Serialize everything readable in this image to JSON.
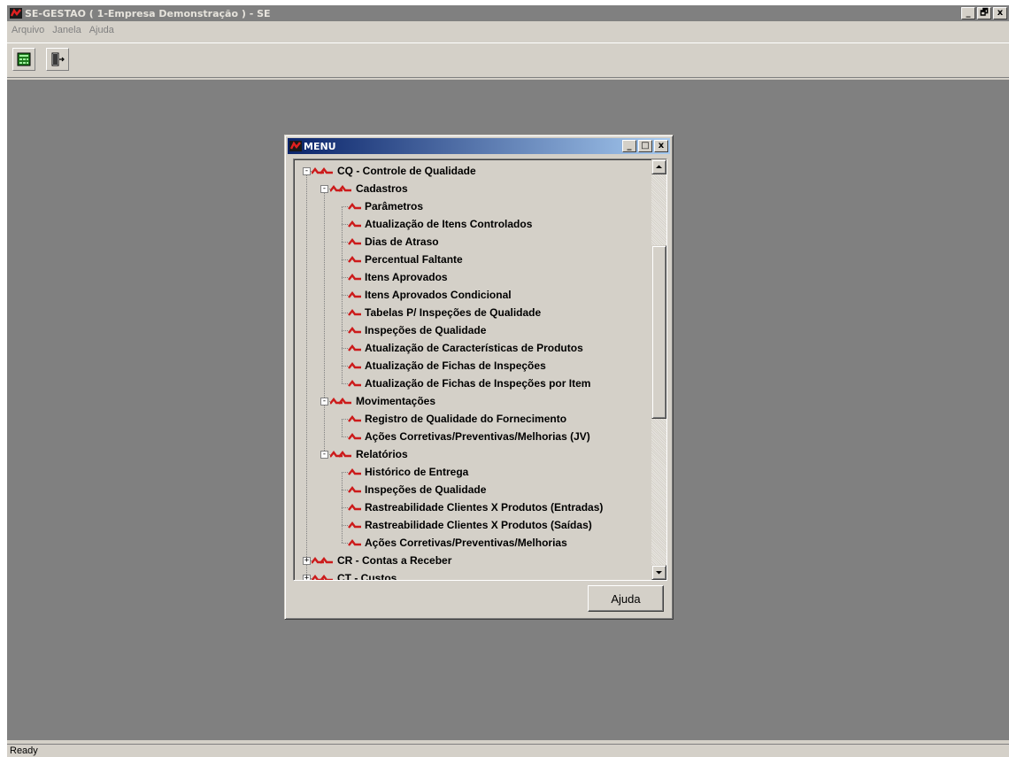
{
  "window": {
    "title": "SE-GESTAO ( 1-Empresa Demonstração ) - SE",
    "controls": [
      "_",
      "🗗",
      "x"
    ]
  },
  "menubar": {
    "items": [
      "Arquivo",
      "Janela",
      "Ajuda"
    ]
  },
  "toolbar": {
    "buttons": [
      "grid-menu-icon",
      "exit-door-icon"
    ]
  },
  "status": {
    "text": "Ready"
  },
  "menu_window": {
    "title": "MENU",
    "controls": [
      "_",
      "□",
      "x"
    ],
    "help_label": "Ajuda",
    "tree": [
      {
        "label": "CQ - Controle de Qualidade",
        "level": 0,
        "expand": "-"
      },
      {
        "label": "Cadastros",
        "level": 1,
        "expand": "-"
      },
      {
        "label": "Parâmetros",
        "level": 2
      },
      {
        "label": "Atualização de Itens Controlados",
        "level": 2
      },
      {
        "label": "Dias de Atraso",
        "level": 2
      },
      {
        "label": "Percentual Faltante",
        "level": 2
      },
      {
        "label": "Itens Aprovados",
        "level": 2
      },
      {
        "label": "Itens Aprovados Condicional",
        "level": 2
      },
      {
        "label": "Tabelas P/ Inspeções de Qualidade",
        "level": 2
      },
      {
        "label": "Inspeções de Qualidade",
        "level": 2
      },
      {
        "label": "Atualização de Características de Produtos",
        "level": 2
      },
      {
        "label": "Atualização de Fichas de Inspeções",
        "level": 2
      },
      {
        "label": "Atualização de Fichas de Inspeções por Item",
        "level": 2
      },
      {
        "label": "Movimentações",
        "level": 1,
        "expand": "-"
      },
      {
        "label": "Registro de Qualidade do Fornecimento",
        "level": 2
      },
      {
        "label": "Ações Corretivas/Preventivas/Melhorias (JV)",
        "level": 2
      },
      {
        "label": "Relatórios",
        "level": 1,
        "expand": "-"
      },
      {
        "label": "Histórico de Entrega",
        "level": 2
      },
      {
        "label": "Inspeções de Qualidade",
        "level": 2
      },
      {
        "label": "Rastreabilidade Clientes X Produtos (Entradas)",
        "level": 2
      },
      {
        "label": "Rastreabilidade Clientes X Produtos (Saídas)",
        "level": 2
      },
      {
        "label": "Ações Corretivas/Preventivas/Melhorias",
        "level": 2
      },
      {
        "label": "CR - Contas a Receber",
        "level": 0,
        "expand": "+"
      },
      {
        "label": "CT - Custos",
        "level": 0,
        "expand": "+"
      }
    ]
  },
  "colors": {
    "title_inactive": "#808080",
    "mdi_title_start": "#0a246a",
    "mdi_title_end": "#a6caf0",
    "workspace": "#808080",
    "face": "#d4d0c8",
    "node_icon": "#cc1b1b"
  }
}
